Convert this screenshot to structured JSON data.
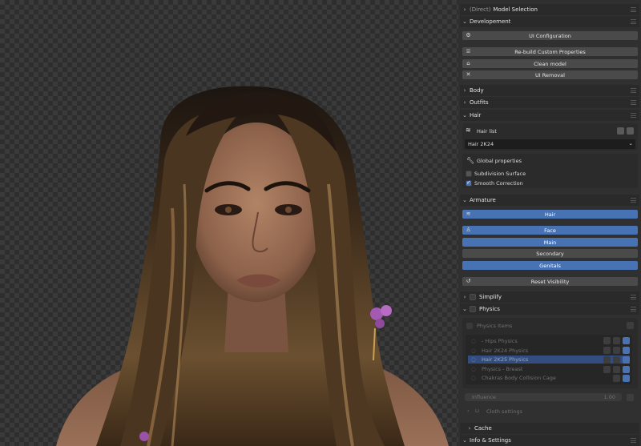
{
  "sidebar": {
    "model_selection_prefix": "(Direct)",
    "model_selection": "Model Selection",
    "developement": "Developement",
    "ui_configuration": "UI Configuration",
    "rebuild_custom_properties": "Re-build Custom Properties",
    "clean_model": "Clean model",
    "ui_removal": "UI Removal",
    "body": "Body",
    "outfits": "Outfits",
    "hair": "Hair",
    "hair_list_label": "Hair list",
    "hair_list_value": "Hair 2K24",
    "global_properties": "Global properties",
    "subdivision_surface": "Subdivision Surface",
    "smooth_correction": "Smooth Correction",
    "armature": "Armature",
    "armature_buttons": [
      "Hair",
      "Face",
      "Main",
      "Secondary",
      "Genitals"
    ],
    "reset_visibility": "Reset Visibility",
    "simplify": "Simplify",
    "physics": "Physics",
    "physics_items": "Physics Items",
    "physics_list": [
      "- Hips Physics",
      "Hair 2K24 Physics",
      "Hair 2K25 Physics",
      "Physics - Breast",
      "Chakras Body Collision Cage"
    ],
    "influence_label": "Influence",
    "influence_value": "1.00",
    "cloth_settings": "Cloth settings",
    "cache": "Cache",
    "info_settings": "Info & Settings"
  },
  "colors": {
    "accent": "#4772b3",
    "panel": "#303030",
    "header": "#2a2a2a"
  }
}
